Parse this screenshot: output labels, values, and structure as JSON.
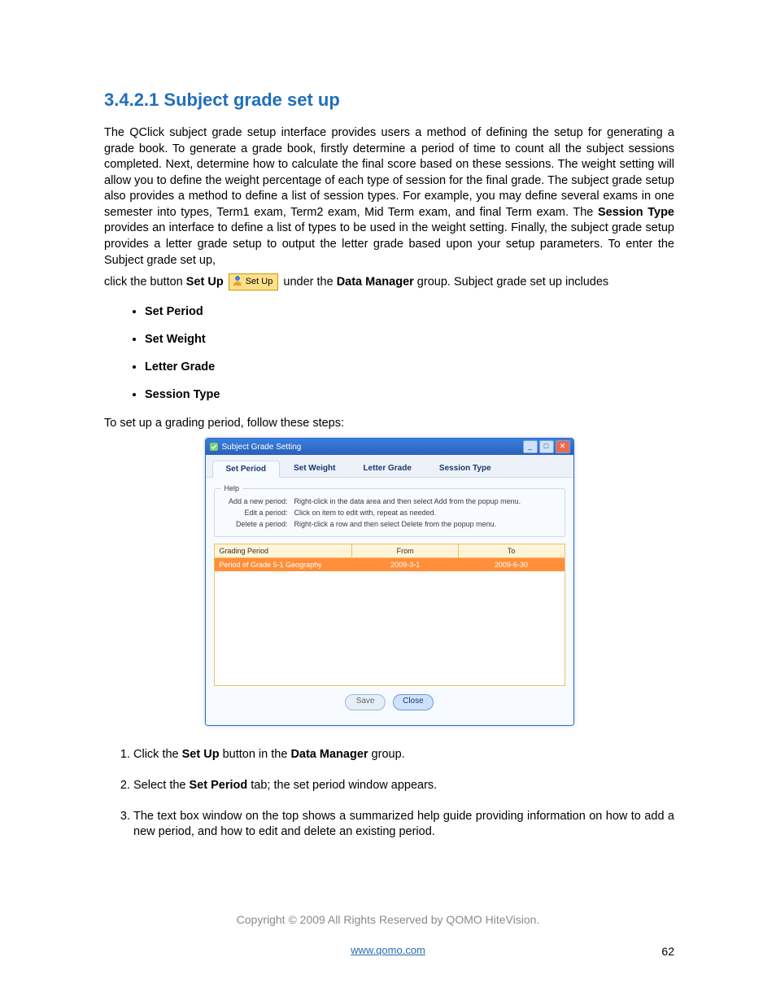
{
  "heading": "3.4.2.1 Subject grade set up",
  "para1": "The QClick subject grade setup interface provides users a method of defining the setup for generating a grade book. To generate a grade book, firstly determine a period of time to count all the subject sessions completed. Next, determine how to calculate the final score based on these sessions. The weight setting will allow you to define the weight percentage of each type of session for the final grade. The subject grade setup also provides a method to define a list of session types. For example, you may define several exams in one semester into types, Term1 exam, Term2 exam, Mid Term exam, and final Term exam. The ",
  "para1_bold": "Session Type",
  "para1b": " provides an interface to define a list of types to be used in the weight setting. Finally, the subject grade setup provides a letter grade setup to output the letter grade based upon your setup parameters. To enter the Subject grade set up,",
  "para2_a": "click the button ",
  "para2_b": "Set Up",
  "inline_button_label": "Set Up",
  "para2_c": "under the ",
  "para2_d": "Data Manager",
  "para2_e": " group. Subject grade set up includes",
  "bullets": [
    "Set Period",
    "Set Weight",
    "Letter Grade",
    "Session Type"
  ],
  "para3": "To set up a grading period, follow these steps:",
  "screenshot": {
    "window_title": "Subject Grade Setting",
    "tabs": [
      "Set Period",
      "Set Weight",
      "Letter Grade",
      "Session Type"
    ],
    "active_tab": 0,
    "help_legend": "Help",
    "help_rows": [
      {
        "label": "Add a new period:",
        "text": "Right-click in the data area and then select Add from the popup menu."
      },
      {
        "label": "Edit a period:",
        "text": "Click on item to edit with, repeat as needed."
      },
      {
        "label": "Delete a period:",
        "text": "Right-click a row and then select Delete from the popup menu."
      }
    ],
    "columns": [
      "Grading Period",
      "From",
      "To"
    ],
    "row": {
      "name": "Period of Grade 5-1 Geography",
      "from": "2009-3-1",
      "to": "2009-6-30"
    },
    "buttons": {
      "save": "Save",
      "close": "Close"
    }
  },
  "steps": [
    {
      "pre": "Click the ",
      "b1": "Set Up",
      "mid": " button in the ",
      "b2": "Data Manager",
      "post": " group."
    },
    {
      "pre": "Select the ",
      "b1": "Set Period",
      "mid": " tab; the set period window appears.",
      "b2": "",
      "post": ""
    },
    {
      "pre": "The text box window on the top shows a summarized help guide providing information on how to add a new period, and how to edit and delete an existing period.",
      "b1": "",
      "mid": "",
      "b2": "",
      "post": ""
    }
  ],
  "copyright": "Copyright © 2009 All Rights Reserved by QOMO HiteVision.",
  "url": "www.qomo.com",
  "page_number": "62"
}
